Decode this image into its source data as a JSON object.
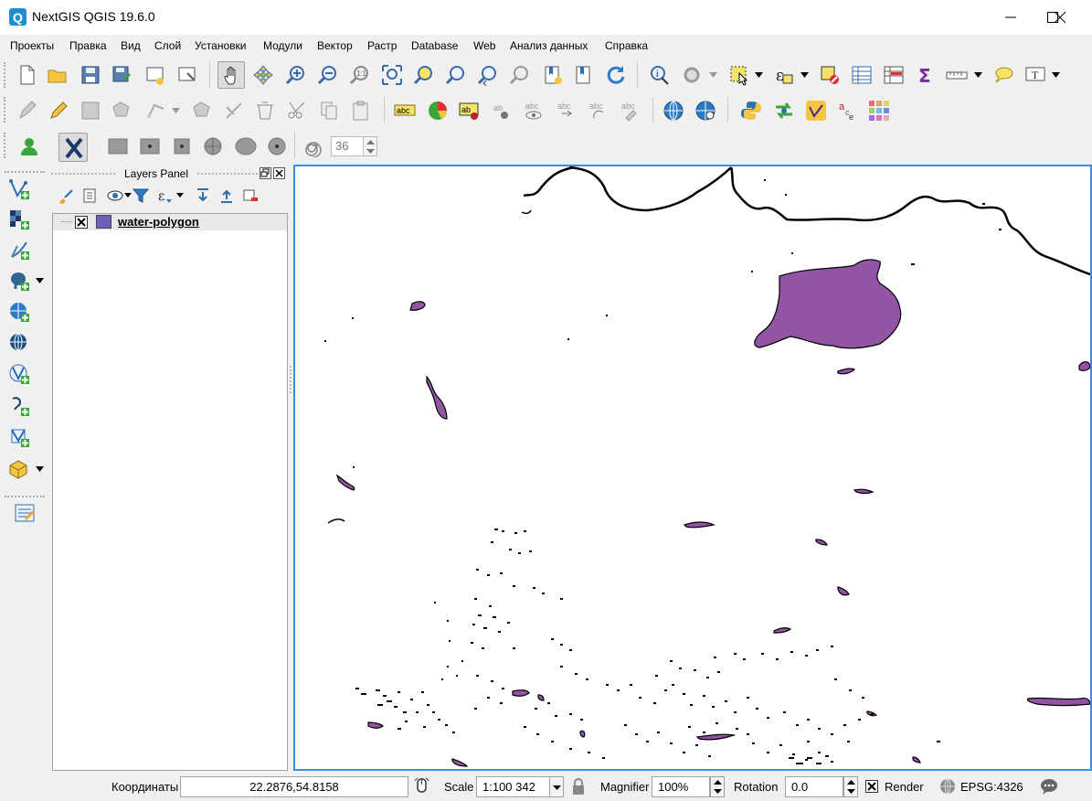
{
  "window": {
    "title": "NextGIS QGIS 19.6.0"
  },
  "menu": [
    "Проекты",
    "Правка",
    "Вид",
    "Слой",
    "Установки",
    "Модули",
    "Вектор",
    "Растр",
    "Database",
    "Web",
    "Анализ данных",
    "Справка"
  ],
  "toolbar3": {
    "rotation_value": "36"
  },
  "layers_panel": {
    "title": "Layers Panel",
    "layers": [
      {
        "name": "water-polygon",
        "visible": true,
        "color": "#6d5fbc"
      }
    ]
  },
  "map": {
    "fill_color": "#9155a4",
    "stroke_color": "#000000",
    "border_color": "#3a8ee6"
  },
  "status": {
    "coord_label": "Координаты",
    "coord_value": "22.2876,54.8158",
    "scale_label": "Scale",
    "scale_value": "1:100 342",
    "magnifier_label": "Magnifier",
    "magnifier_value": "100%",
    "rotation_label": "Rotation",
    "rotation_value": "0.0",
    "render_label": "Render",
    "render_checked": true,
    "crs": "EPSG:4326"
  },
  "icons": [
    "new-project-icon",
    "open-project-icon",
    "save-project-icon",
    "save-as-icon",
    "new-print-layout-icon",
    "layout-manager-icon",
    "pan-icon",
    "pan-to-selection-icon",
    "zoom-in-icon",
    "zoom-out-icon",
    "zoom-native-icon",
    "zoom-full-icon",
    "zoom-to-selection-icon",
    "zoom-to-layer-icon",
    "zoom-last-icon",
    "zoom-next-icon",
    "new-bookmark-icon",
    "show-bookmarks-icon",
    "refresh-icon",
    "identify-icon",
    "run-action-icon",
    "select-features-icon",
    "select-by-expression-icon",
    "deselect-icon",
    "attribute-table-icon",
    "field-calculator-icon",
    "statistics-icon",
    "measure-icon",
    "map-tips-icon",
    "text-annotation-icon"
  ]
}
